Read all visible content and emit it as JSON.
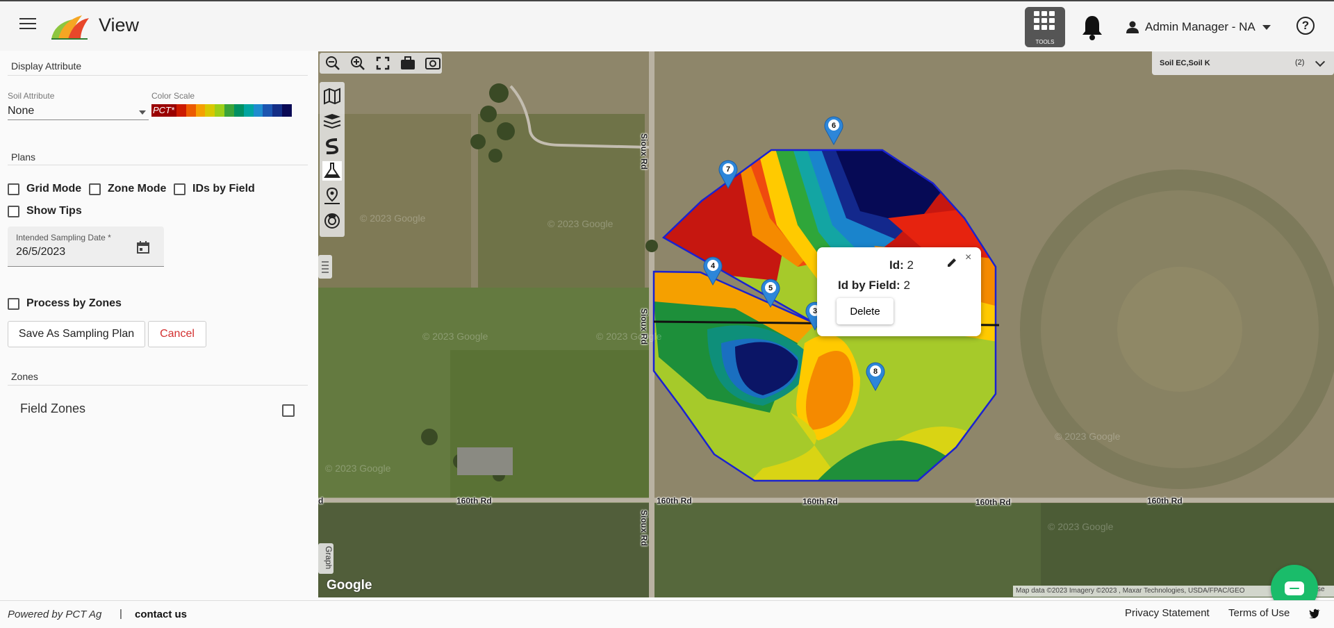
{
  "header": {
    "app_title": "View",
    "tools_label": "TOOLS",
    "user_name": "Admin Manager - NA",
    "help_glyph": "?",
    "icons": [
      "menu-icon",
      "app-logo",
      "tools-grid-icon",
      "bell-icon",
      "user-icon",
      "dropdown-caret-icon",
      "help-icon"
    ]
  },
  "sidebar": {
    "display_attribute_heading": "Display Attribute",
    "soil_attribute_label": "Soil Attribute",
    "soil_attribute_value": "None",
    "color_scale_label": "Color Scale",
    "color_scale_name": "PCT*",
    "color_scale_colors": [
      "#cc1a00",
      "#ec5b00",
      "#f5a000",
      "#d8c800",
      "#9ccf18",
      "#3aa33a",
      "#009062",
      "#00a5a0",
      "#1e8ccf",
      "#1c55b0",
      "#142e86",
      "#0a0a55"
    ],
    "plans_heading": "Plans",
    "grid_mode_label": "Grid Mode",
    "zone_mode_label": "Zone Mode",
    "ids_by_field_label": "IDs by Field",
    "show_tips_label": "Show Tips",
    "date_label": "Intended Sampling Date *",
    "date_value": "26/5/2023",
    "process_by_zones_label": "Process by Zones",
    "save_button_label": "Save As Sampling Plan",
    "cancel_button_label": "Cancel",
    "zones_heading": "Zones",
    "field_zones_label": "Field Zones"
  },
  "map": {
    "layers_label": "Soil EC,Soil K",
    "layers_count": "(2)",
    "roads": {
      "sioux_rd": "Sioux Rd",
      "h_160th": "160th Rd",
      "d_fragment": "d"
    },
    "watermark": "© 2023 Google",
    "google_label": "Google",
    "attribution": "Map data ©2023 Imagery ©2023 , Maxar Technologies, USDA/FPAC/GEO",
    "attribution_tail": "se",
    "graph_tab_label": "Graph",
    "sample_points": [
      "2",
      "3",
      "4",
      "5",
      "6",
      "7",
      "8"
    ],
    "top_tools": [
      "zoom-out-icon",
      "zoom-in-icon",
      "fit-extent-icon",
      "briefcase-icon",
      "screenshot-icon"
    ],
    "side_tools": [
      "map-layer-icon",
      "layers-icon",
      "soil-icon",
      "sampling-icon",
      "location-pin-icon",
      "scanner-icon"
    ],
    "popup": {
      "id_key": "Id:",
      "id_value": "2",
      "field_id_key": "Id by Field:",
      "field_id_value": "2",
      "close_glyph": "×",
      "delete_label": "Delete"
    }
  },
  "footer": {
    "powered_by": "Powered by PCT Ag",
    "separator": "|",
    "contact": "contact us",
    "privacy": "Privacy Statement",
    "terms": "Terms of Use"
  }
}
